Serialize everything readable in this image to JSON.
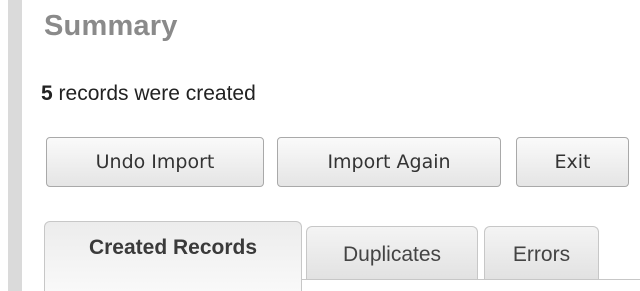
{
  "summary": {
    "title": "Summary",
    "record_count": "5",
    "status_suffix": " records were created"
  },
  "actions": {
    "undo_label": "Undo Import",
    "import_again_label": "Import Again",
    "exit_label": "Exit"
  },
  "tabs": [
    {
      "label": "Created Records",
      "active": true
    },
    {
      "label": "Duplicates",
      "active": false
    },
    {
      "label": "Errors",
      "active": false
    }
  ]
}
